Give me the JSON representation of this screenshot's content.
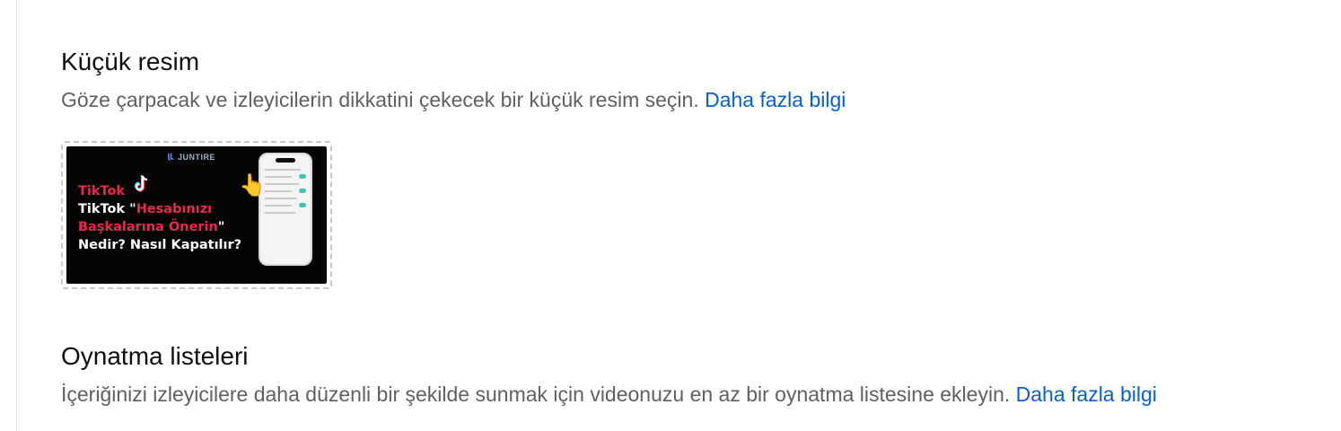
{
  "thumbnail_section": {
    "title": "Küçük resim",
    "description": "Göze çarpacak ve izleyicilerin dikkatini çekecek bir küçük resim seçin.",
    "learn_more": "Daha fazla bilgi",
    "thumbnail": {
      "brand": "JUNTIRE",
      "line1_red": "TikTok",
      "line2_white": "TikTok \"",
      "line2_red": "Hesabınızı",
      "line3_red": "Başkalarına Önerin",
      "line3_white": "\"",
      "line4_white": "Nedir? Nasıl Kapatılır?"
    }
  },
  "playlists_section": {
    "title": "Oynatma listeleri",
    "description": "İçeriğinizi izleyicilere daha düzenli bir şekilde sunmak için videonuzu en az bir oynatma listesine ekleyin.",
    "learn_more": "Daha fazla bilgi"
  },
  "colors": {
    "link": "#065fd4",
    "secondary_text": "#606060",
    "thumbnail_accent": "#e8294e"
  },
  "icons": {
    "brand": "juntire-logo-icon",
    "tiktok": "tiktok-icon",
    "hand": "pointing-hand-icon"
  }
}
